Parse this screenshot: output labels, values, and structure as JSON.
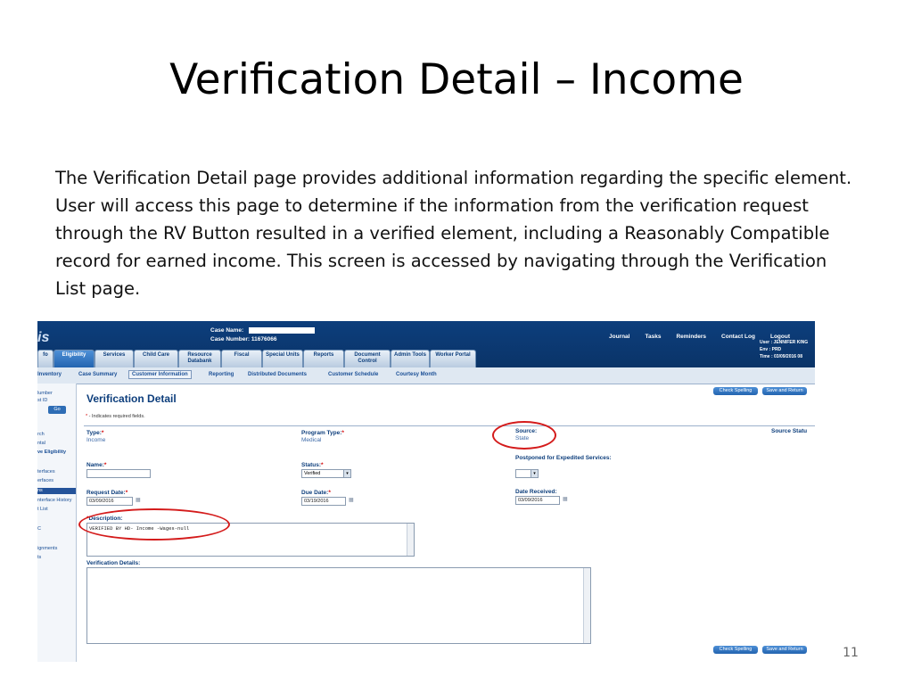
{
  "slide": {
    "title": "Verification Detail – Income",
    "body": "The Verification Detail page provides additional information regarding the specific element. User will access this page to determine if the information from the verification request through the RV  Button resulted in a verified element, including a Reasonably Compatible  record for earned income. This screen  is accessed by navigating through the Verification List page.",
    "page_number": "11"
  },
  "screenshot": {
    "header": {
      "logo": "is",
      "case_name_label": "Case Name:",
      "case_number_label": "Case Number:",
      "case_number": "11676066",
      "nav": [
        "Journal",
        "Tasks",
        "Reminders",
        "Contact Log",
        "Logout"
      ],
      "user_line": "User : JENNIFER KING",
      "env_line": "Env : PRD",
      "time_line": "Time : 03/09/2016 08"
    },
    "tabs": [
      {
        "label": "fo"
      },
      {
        "label": "Eligibility"
      },
      {
        "label": "Services"
      },
      {
        "label": "Child Care"
      },
      {
        "label": "Resource Databank"
      },
      {
        "label": "Fiscal"
      },
      {
        "label": "Special Units"
      },
      {
        "label": "Reports"
      },
      {
        "label": "Document Control"
      },
      {
        "label": "Admin Tools"
      },
      {
        "label": "Worker Portal"
      }
    ],
    "subnav": [
      "Inventory",
      "Case Summary",
      "Customer Information",
      "Reporting",
      "Distributed Documents",
      "Customer Schedule",
      "Courtesy Month"
    ],
    "left_panel": {
      "line1": "lumber",
      "line2": "st ID",
      "go": "Go",
      "items": [
        "rch",
        "ntal",
        "ve Eligibility",
        "terfaces",
        "erfaces",
        "ns",
        "nterface History",
        "t List",
        "C",
        "ignments",
        "ts"
      ]
    },
    "page": {
      "title": "Verification Detail",
      "required_note": "- Indicates required fields.",
      "check_spelling": "Check Spelling",
      "save_and_return": "Save and Return",
      "type_label": "Type:",
      "type_value": "Income",
      "program_type_label": "Program Type:",
      "program_type_value": "Medical",
      "source_label": "Source:",
      "source_value": "State",
      "source_status_label": "Source Statu",
      "name_label": "Name:",
      "status_label": "Status:",
      "status_value": "Verified",
      "postponed_label": "Postponed for Expedited Services:",
      "request_date_label": "Request Date:",
      "request_date": "03/09/2016",
      "due_date_label": "Due Date:",
      "due_date": "03/19/2016",
      "date_received_label": "Date Received:",
      "date_received": "03/09/2016",
      "description_label": "Description:",
      "description_value": "VERIFIED BY HD- Income -Wages-null",
      "verification_details_label": "Verification Details:"
    },
    "colors": {
      "header": "#0d3e7c",
      "highlight_circle": "#d41b1b",
      "label": "#0d3e7c"
    }
  }
}
